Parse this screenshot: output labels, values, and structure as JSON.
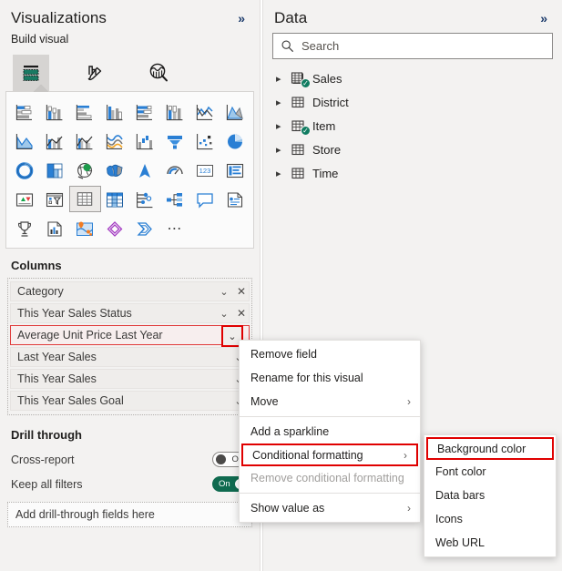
{
  "visualizations": {
    "title": "Visualizations",
    "collapse_icon": "chevron-double-right-icon",
    "build_visual_label": "Build visual",
    "tabs": [
      {
        "name": "build-visual-tab",
        "icon": "table-visual-icon",
        "selected": true
      },
      {
        "name": "format-visual-tab",
        "icon": "paintbrush-icon",
        "selected": false
      },
      {
        "name": "analytics-tab",
        "icon": "magnifier-chart-icon",
        "selected": false
      }
    ],
    "gallery_icons": [
      "stacked-bar-chart-icon",
      "stacked-column-chart-icon",
      "clustered-bar-chart-icon",
      "clustered-column-chart-icon",
      "hundred-percent-stacked-bar-icon",
      "hundred-percent-stacked-column-icon",
      "line-chart-icon",
      "area-chart-icon",
      "stacked-area-chart-icon",
      "line-and-stacked-column-icon",
      "line-and-clustered-column-icon",
      "ribbon-chart-icon",
      "waterfall-chart-icon",
      "funnel-chart-icon",
      "scatter-chart-icon",
      "pie-chart-icon",
      "donut-chart-icon",
      "treemap-icon",
      "map-icon",
      "filled-map-icon",
      "azure-map-icon",
      "gauge-icon",
      "card-icon",
      "multi-row-card-icon",
      "kpi-icon",
      "slicer-icon",
      "table-icon",
      "matrix-icon",
      "dot-plot-icon",
      "decomposition-tree-icon",
      "qanda-icon",
      "smart-narrative-icon",
      "metrics-icon",
      "paginated-report-icon",
      "arcgis-map-icon",
      "power-apps-icon",
      "power-automate-icon",
      "more-options-icon"
    ],
    "selected_gallery_icon": "table-icon",
    "columns_section": {
      "title": "Columns",
      "fields": [
        {
          "label": "Category",
          "has_remove": true,
          "highlighted": false
        },
        {
          "label": "This Year Sales Status",
          "has_remove": true,
          "highlighted": false
        },
        {
          "label": "Average Unit Price Last Year",
          "has_remove": false,
          "highlighted": true
        },
        {
          "label": "Last Year Sales",
          "has_remove": false,
          "highlighted": false
        },
        {
          "label": "This Year Sales",
          "has_remove": false,
          "highlighted": false
        },
        {
          "label": "This Year Sales Goal",
          "has_remove": false,
          "highlighted": false
        }
      ]
    },
    "drill_through": {
      "title": "Drill through",
      "cross_report": {
        "label": "Cross-report",
        "state": "Off"
      },
      "keep_all_filters": {
        "label": "Keep all filters",
        "state": "On"
      },
      "drop_zone_placeholder": "Add drill-through fields here"
    }
  },
  "data_panel": {
    "title": "Data",
    "collapse_icon": "chevron-double-right-icon",
    "search": {
      "placeholder": "Search",
      "value": "",
      "icon": "search-icon"
    },
    "tables": [
      {
        "label": "Sales",
        "icon": "measure-table-icon",
        "checked": true
      },
      {
        "label": "District",
        "icon": "table-icon",
        "checked": false
      },
      {
        "label": "Item",
        "icon": "table-icon",
        "checked": true
      },
      {
        "label": "Store",
        "icon": "table-icon",
        "checked": false
      },
      {
        "label": "Time",
        "icon": "table-icon",
        "checked": false
      }
    ]
  },
  "context_menu": {
    "items": [
      {
        "label": "Remove field",
        "submenu": false,
        "disabled": false,
        "highlighted": false
      },
      {
        "label": "Rename for this visual",
        "submenu": false,
        "disabled": false,
        "highlighted": false
      },
      {
        "label": "Move",
        "submenu": true,
        "disabled": false,
        "highlighted": false
      },
      {
        "separator": true
      },
      {
        "label": "Add a sparkline",
        "submenu": false,
        "disabled": false,
        "highlighted": false
      },
      {
        "label": "Conditional formatting",
        "submenu": true,
        "disabled": false,
        "highlighted": true
      },
      {
        "label": "Remove conditional formatting",
        "submenu": false,
        "disabled": true,
        "highlighted": false
      },
      {
        "separator": true
      },
      {
        "label": "Show value as",
        "submenu": true,
        "disabled": false,
        "highlighted": false
      }
    ]
  },
  "submenu": {
    "items": [
      {
        "label": "Background color",
        "highlighted": true
      },
      {
        "label": "Font color",
        "highlighted": false
      },
      {
        "label": "Data bars",
        "highlighted": false
      },
      {
        "label": "Icons",
        "highlighted": false
      },
      {
        "label": "Web URL",
        "highlighted": false
      }
    ]
  },
  "colors": {
    "accent_blue": "#2a7fd4",
    "accent_gray": "#9a9a9a",
    "highlight_red": "#e00000",
    "teal_green": "#0f6a4f",
    "panel_bg": "#f3f2f1"
  }
}
